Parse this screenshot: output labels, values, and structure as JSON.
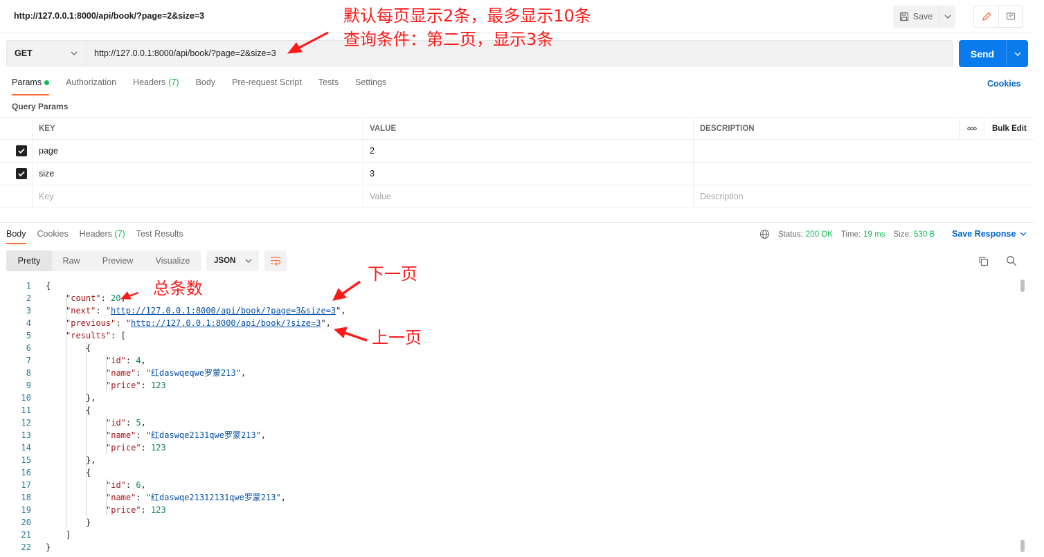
{
  "request": {
    "title": "http://127.0.0.1:8000/api/book/?page=2&size=3",
    "method": "GET",
    "url": "http://127.0.0.1:8000/api/book/?page=2&size=3",
    "save_label": "Save",
    "send_label": "Send"
  },
  "request_tabs": [
    {
      "label": "Params",
      "count": "",
      "active": true
    },
    {
      "label": "Authorization",
      "count": ""
    },
    {
      "label": "Headers",
      "count": "(7)"
    },
    {
      "label": "Body",
      "count": ""
    },
    {
      "label": "Pre-request Script",
      "count": ""
    },
    {
      "label": "Tests",
      "count": ""
    },
    {
      "label": "Settings",
      "count": ""
    }
  ],
  "cookies_link": "Cookies",
  "query_params": {
    "title": "Query Params",
    "headers": [
      "KEY",
      "VALUE",
      "DESCRIPTION"
    ],
    "more_glyph": "ooo",
    "bulk_edit": "Bulk Edit",
    "rows": [
      {
        "key": "page",
        "value": "2",
        "checked": true
      },
      {
        "key": "size",
        "value": "3",
        "checked": true
      }
    ],
    "placeholders": {
      "key": "Key",
      "value": "Value",
      "description": "Description"
    }
  },
  "response_tabs": [
    {
      "label": "Body",
      "count": "",
      "active": true
    },
    {
      "label": "Cookies",
      "count": ""
    },
    {
      "label": "Headers",
      "count": "(7)"
    },
    {
      "label": "Test Results",
      "count": ""
    }
  ],
  "response_status": {
    "status_label": "Status:",
    "status_value": "200 OK",
    "time_label": "Time:",
    "time_value": "19 ms",
    "size_label": "Size:",
    "size_value": "530 B",
    "save_response": "Save Response"
  },
  "view_options": [
    "Pretty",
    "Raw",
    "Preview",
    "Visualize"
  ],
  "format": "JSON",
  "code_lines": [
    "{",
    "\"count\": 20,",
    "\"next\": \"http://127.0.0.1:8000/api/book/?page=3&size=3\",",
    "\"previous\": \"http://127.0.0.1:8000/api/book/?size=3\",",
    "\"results\": [",
    "{",
    "\"id\": 4,",
    "\"name\": \"红daswqeqwe罗蒙213\",",
    "\"price\": 123",
    "},",
    "{",
    "\"id\": 5,",
    "\"name\": \"红daswqe2131qwe罗蒙213\",",
    "\"price\": 123",
    "},",
    "{",
    "\"id\": 6,",
    "\"name\": \"红daswqe21312131qwe罗蒙213\",",
    "\"price\": 123",
    "}",
    "]",
    "}"
  ],
  "annotations": {
    "top_line1": "默认每页显示2条，最多显示10条",
    "top_line2": "查询条件：第二页，显示3条",
    "total": "总条数",
    "next_page": "下一页",
    "prev_page": "上一页"
  },
  "colors": {
    "accent_orange": "#ff6c37",
    "send_blue": "#097bed",
    "link_blue": "#0265d2",
    "status_green": "#0cbb52",
    "annotation_red": "#ff1a1a"
  }
}
